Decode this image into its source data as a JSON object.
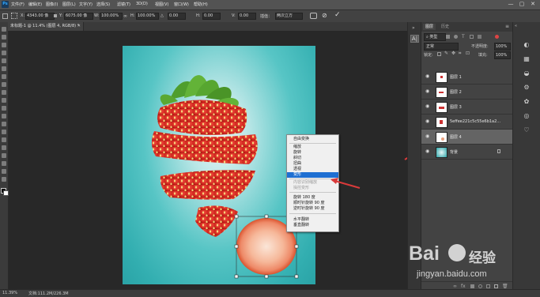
{
  "menubar": {
    "items": [
      "文件(F)",
      "编辑(E)",
      "图像(I)",
      "图层(L)",
      "文字(Y)",
      "选择(S)",
      "滤镜(T)",
      "3D(D)",
      "视图(V)",
      "窗口(W)",
      "帮助(H)"
    ],
    "window_controls": [
      "—",
      "▢",
      "✕"
    ]
  },
  "options_bar": {
    "x_label": "X:",
    "x_value": "4343.00 像",
    "y_label": "Y:",
    "y_value": "6075.00 像",
    "w_label": "W:",
    "w_value": "100.00%",
    "h_label": "H:",
    "h_value": "100.00%",
    "angle_label": "△",
    "angle_value": "0.00",
    "hskew_label": "H:",
    "hskew_value": "0.00",
    "vskew_label": "V:",
    "vskew_value": "0.00",
    "interp_label": "插值：",
    "interp_value": "两次立方"
  },
  "document": {
    "tab_title": "未标题-1 @ 11.4% (图层 4, RGB/8) *",
    "zoom_status": "11.39%",
    "doc_size": "文档:111.2M/226.3M"
  },
  "layers_panel": {
    "tabs": [
      "图层",
      "历史"
    ],
    "filter_value": "类型",
    "blend_mode": "正常",
    "opacity_label": "不透明度:",
    "opacity_value": "100%",
    "lock_label": "锁定:",
    "fill_label": "填充:",
    "fill_value": "100%",
    "layers": [
      {
        "name": "图层 1"
      },
      {
        "name": "图层 2"
      },
      {
        "name": "图层 3"
      },
      {
        "name": "5effee221c5c55e6b1a2..."
      },
      {
        "name": "图层 4"
      },
      {
        "name": "背景"
      }
    ]
  },
  "context_menu": {
    "items": [
      {
        "label": "自由变换"
      },
      {
        "label": "缩放"
      },
      {
        "label": "旋转"
      },
      {
        "label": "斜切"
      },
      {
        "label": "扭曲"
      },
      {
        "label": "透视"
      },
      {
        "label": "变形"
      },
      {
        "label": "内容识别缩放"
      },
      {
        "label": "操控变形"
      },
      {
        "label": "旋转 180 度"
      },
      {
        "label": "顺时针旋转 90 度"
      },
      {
        "label": "逆时针旋转 90 度"
      },
      {
        "label": "水平翻转"
      },
      {
        "label": "垂直翻转"
      }
    ]
  },
  "watermark": {
    "brand": "Bai",
    "brand_suffix": "经验",
    "url": "jingyan.baidu.com"
  },
  "colors": {
    "menubar": "#535353",
    "panel": "#434343",
    "canvas_bg": "#282828",
    "menu_highlight": "#1e6fd2",
    "arrow_red": "#d93a3a",
    "teal_bg": "#2aa3a6"
  }
}
